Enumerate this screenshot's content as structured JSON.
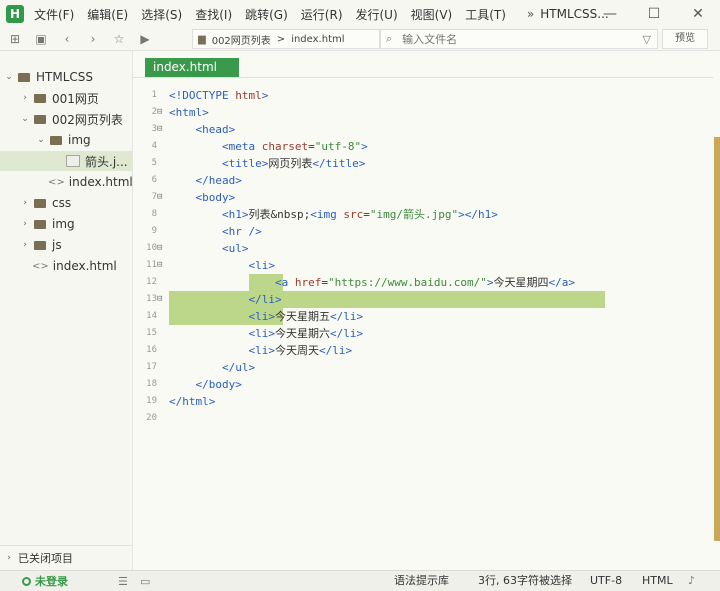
{
  "window": {
    "logo": "H",
    "app_title": "HTMLCSS...",
    "menu": [
      "文件(F)",
      "编辑(E)",
      "选择(S)",
      "查找(I)",
      "跳转(G)",
      "运行(R)",
      "发行(U)",
      "视图(V)",
      "工具(T)"
    ],
    "minimize": "—",
    "maximize": "☐",
    "close": "✕"
  },
  "toolbar": {
    "path_folder": "002网页列表",
    "path_sep": ">",
    "path_file": "index.html",
    "file_search_placeholder": "输入文件名",
    "preview_label": "预览"
  },
  "sidebar": {
    "project_root": "HTMLCSS",
    "items": [
      {
        "label": "001网页"
      },
      {
        "label": "002网页列表"
      },
      {
        "label": "img"
      },
      {
        "label": "箭头.j..."
      },
      {
        "label": "index.html"
      },
      {
        "label": "css"
      },
      {
        "label": "img"
      },
      {
        "label": "js"
      },
      {
        "label": "index.html"
      }
    ],
    "closed_projects": "已关闭项目"
  },
  "editor": {
    "tab": "index.html",
    "line_numbers": [
      "1",
      "2",
      "3",
      "4",
      "5",
      "6",
      "7",
      "8",
      "9",
      "10",
      "11",
      "12",
      "13",
      "14",
      "15",
      "16",
      "17",
      "18",
      "19",
      "20"
    ]
  },
  "status": {
    "login": "未登录",
    "syntax_hint": "语法提示库",
    "selection_info": "3行, 63字符被选择",
    "encoding": "UTF-8",
    "language": "HTML"
  },
  "colors": {
    "accent_green": "#3a9a4b",
    "selection": "#bcd78a",
    "scrollbar": "#c9a85a"
  }
}
